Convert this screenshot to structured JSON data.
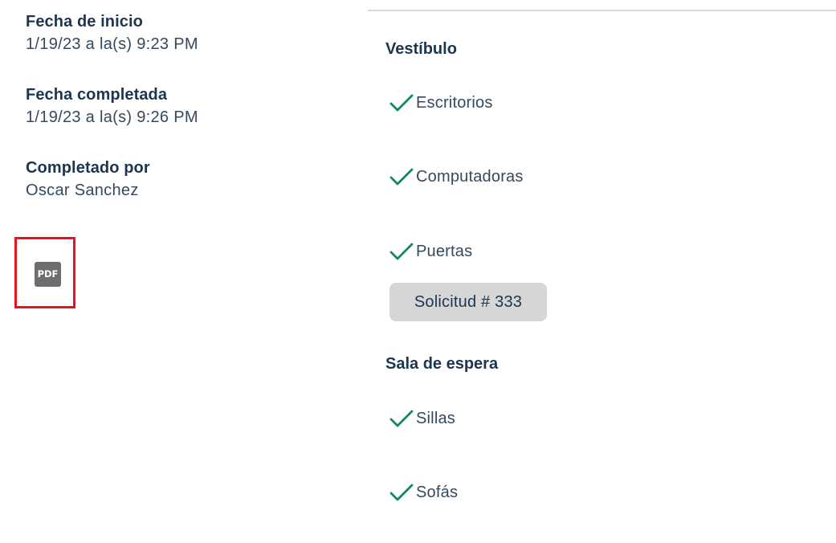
{
  "details": [
    {
      "label": "Fecha de inicio",
      "value": "1/19/23 a la(s) 9:23 PM"
    },
    {
      "label": "Fecha completada",
      "value": "1/19/23 a la(s) 9:26 PM"
    },
    {
      "label": "Completado por",
      "value": "Oscar Sanchez"
    }
  ],
  "pdf": {
    "label": "PDF",
    "highlight_color": "#e8121a"
  },
  "sections": [
    {
      "title": "Vestíbulo",
      "items": [
        {
          "label": "Escritorios",
          "icon": "checkmark-icon"
        },
        {
          "label": "Computadoras",
          "icon": "checkmark-icon"
        },
        {
          "label": "Puertas",
          "icon": "checkmark-icon"
        }
      ],
      "request": {
        "label": "Solicitud # 333"
      }
    },
    {
      "title": "Sala de espera",
      "items": [
        {
          "label": "Sillas",
          "icon": "checkmark-icon"
        },
        {
          "label": "Sofás",
          "icon": "checkmark-icon"
        }
      ]
    }
  ],
  "colors": {
    "check": "#0f8a5f",
    "heading": "#1c3550",
    "text": "#34495e",
    "badge_bg": "#d6d6d6"
  }
}
